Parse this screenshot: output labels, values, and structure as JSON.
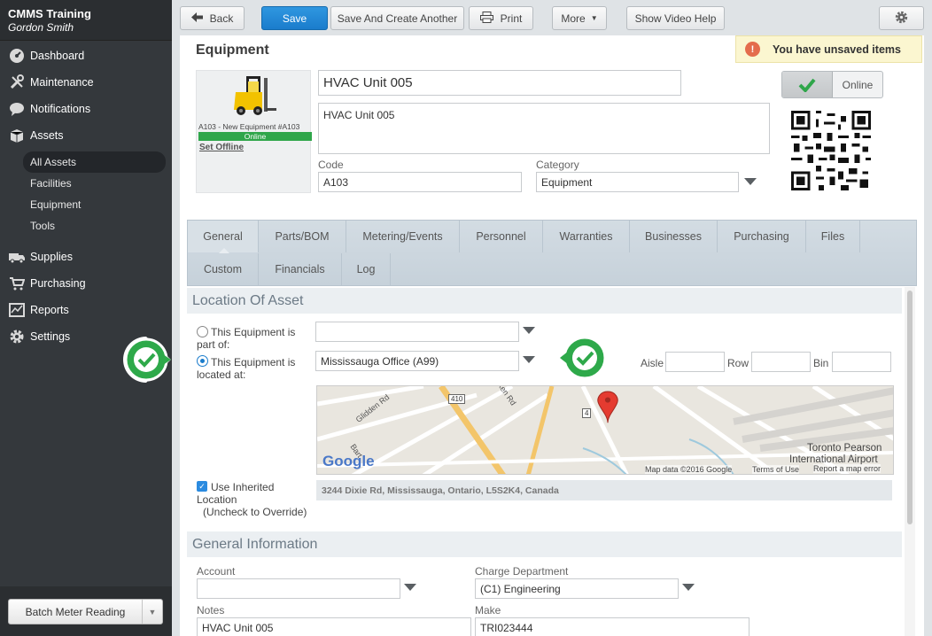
{
  "sidebar": {
    "org": "CMMS Training",
    "user": "Gordon Smith",
    "items": [
      {
        "label": "Dashboard",
        "icon": "dashboard-icon"
      },
      {
        "label": "Maintenance",
        "icon": "tools-icon"
      },
      {
        "label": "Notifications",
        "icon": "chat-bubble-icon"
      },
      {
        "label": "Assets",
        "icon": "boxes-icon"
      }
    ],
    "asset_subitems": [
      "All Assets",
      "Facilities",
      "Equipment",
      "Tools"
    ],
    "items2": [
      {
        "label": "Supplies",
        "icon": "truck-icon"
      },
      {
        "label": "Purchasing",
        "icon": "cart-icon"
      },
      {
        "label": "Reports",
        "icon": "chart-icon"
      },
      {
        "label": "Settings",
        "icon": "gear-icon"
      }
    ],
    "batch_button": "Batch Meter Reading"
  },
  "toolbar": {
    "back": "Back",
    "save": "Save",
    "save_create": "Save And Create Another",
    "print": "Print",
    "more": "More",
    "video_help": "Show Video Help"
  },
  "header": {
    "title": "Equipment",
    "unsaved": "You have unsaved items"
  },
  "equipment": {
    "caption": "A103 - New Equipment #A103",
    "status": "Online",
    "set_offline": "Set Offline",
    "name": "HVAC Unit 005",
    "description": "HVAC Unit 005",
    "code_label": "Code",
    "code": "A103",
    "category_label": "Category",
    "category": "Equipment",
    "online_label": "Online"
  },
  "tabs": {
    "row1": [
      "General",
      "Parts/BOM",
      "Metering/Events",
      "Personnel",
      "Warranties",
      "Businesses",
      "Purchasing",
      "Files"
    ],
    "row2": [
      "Custom",
      "Financials",
      "Log"
    ],
    "active": "General"
  },
  "location": {
    "heading": "Location Of Asset",
    "part_of_label": "This Equipment is part of:",
    "part_of_value": "",
    "located_at_label": "This Equipment is located at:",
    "located_at_value": "Mississauga Office (A99)",
    "aisle_label": "Aisle",
    "row_label": "Row",
    "bin_label": "Bin",
    "inherited_label": "Use Inherited Location",
    "override_note": "(Uncheck to Override)",
    "address": "3244 Dixie Rd, Mississauga, Ontario, L5S2K4, Canada",
    "map": {
      "roads": [
        "Glidden Rd",
        "Bart",
        "ken Rd"
      ],
      "shields": [
        "410",
        "4"
      ],
      "airport": "Toronto Pearson",
      "airport2": "International Airport",
      "attribution": "Map data ©2016 Google",
      "terms": "Terms of Use",
      "report": "Report a map error",
      "logo": "Google"
    }
  },
  "general": {
    "heading": "General Information",
    "account_label": "Account",
    "account_value": "",
    "charge_label": "Charge Department",
    "charge_value": "(C1) Engineering",
    "notes_label": "Notes",
    "notes_value": "HVAC Unit 005",
    "make_label": "Make",
    "make_value": "TRI023444"
  },
  "colors": {
    "sidebar_bg": "#34383c",
    "save_blue": "#1a7ccc",
    "online_green": "#2fa64a",
    "callout_green": "#2ea94a",
    "warning_red": "#e46c4c"
  }
}
